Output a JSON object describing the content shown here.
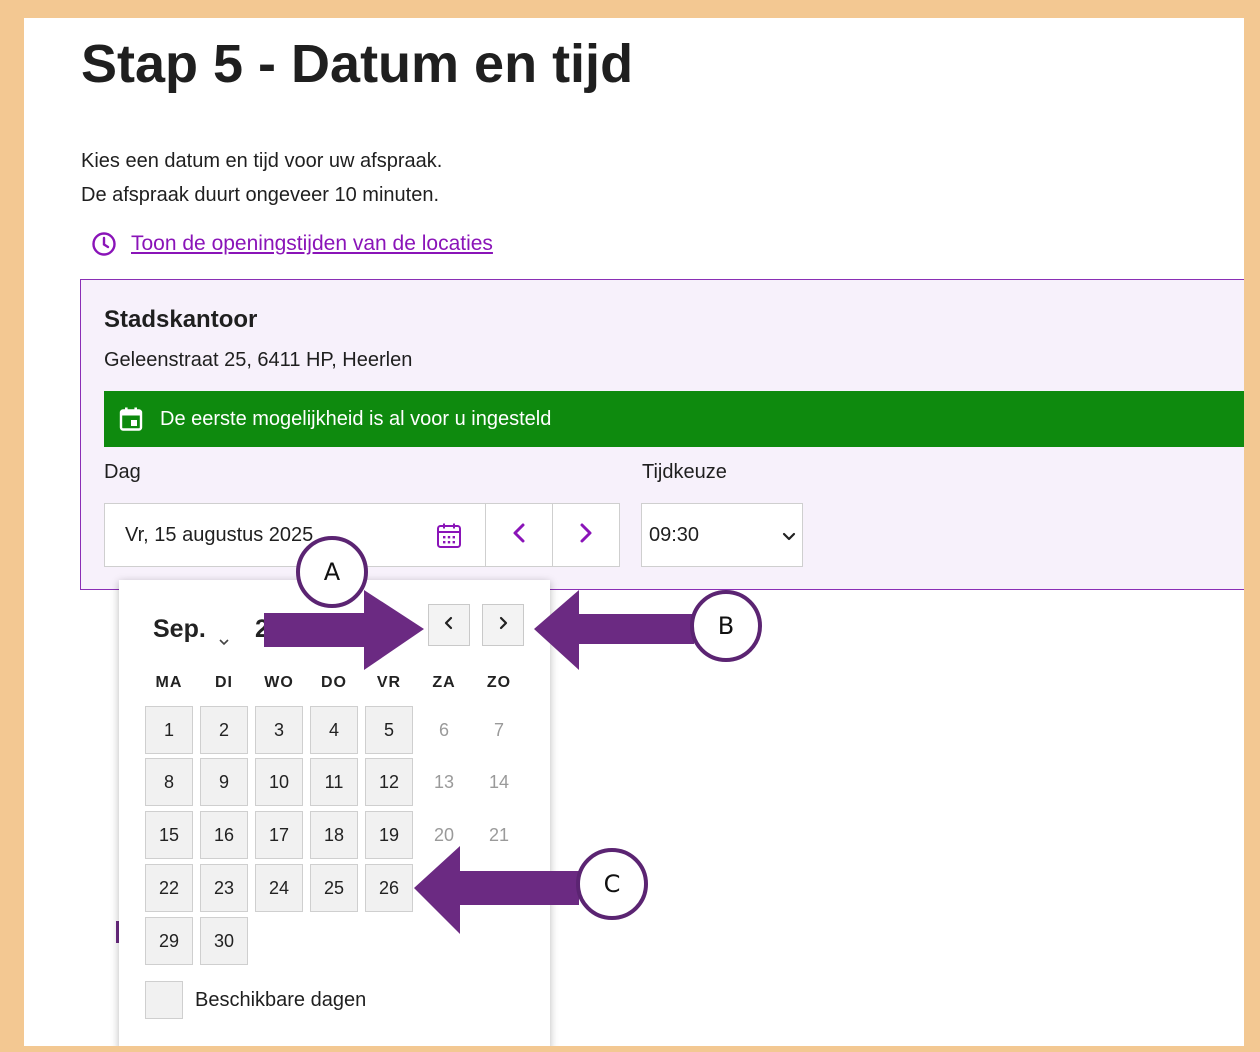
{
  "page": {
    "title": "Stap 5 - Datum en tijd",
    "intro_line1": "Kies een datum en tijd voor uw afspraak.",
    "intro_line2": "De afspraak duurt ongeveer 10 minuten.",
    "hours_link": "Toon de openingstijden van de locaties"
  },
  "location": {
    "name": "Stadskantoor",
    "address": "Geleenstraat 25, 6411 HP, Heerlen",
    "banner": "De eerste mogelijkheid is al voor u ingesteld"
  },
  "form": {
    "day_label": "Dag",
    "day_value": "Vr, 15 augustus 2025",
    "time_label": "Tijdkeuze",
    "time_value": "09:30",
    "prev_day_glyph": "<",
    "next_day_glyph": ">"
  },
  "datepicker": {
    "month_label": "Sep.",
    "year_visible": "2",
    "weekdays": [
      "MA",
      "DI",
      "WO",
      "DO",
      "VR",
      "ZA",
      "ZO"
    ],
    "weeks": [
      [
        {
          "d": "1",
          "available": true
        },
        {
          "d": "2",
          "available": true
        },
        {
          "d": "3",
          "available": true
        },
        {
          "d": "4",
          "available": true
        },
        {
          "d": "5",
          "available": true
        },
        {
          "d": "6",
          "available": false
        },
        {
          "d": "7",
          "available": false
        }
      ],
      [
        {
          "d": "8",
          "available": true
        },
        {
          "d": "9",
          "available": true
        },
        {
          "d": "10",
          "available": true
        },
        {
          "d": "11",
          "available": true
        },
        {
          "d": "12",
          "available": true
        },
        {
          "d": "13",
          "available": false
        },
        {
          "d": "14",
          "available": false
        }
      ],
      [
        {
          "d": "15",
          "available": true
        },
        {
          "d": "16",
          "available": true
        },
        {
          "d": "17",
          "available": true
        },
        {
          "d": "18",
          "available": true
        },
        {
          "d": "19",
          "available": true
        },
        {
          "d": "20",
          "available": false
        },
        {
          "d": "21",
          "available": false
        }
      ],
      [
        {
          "d": "22",
          "available": true
        },
        {
          "d": "23",
          "available": true
        },
        {
          "d": "24",
          "available": true
        },
        {
          "d": "25",
          "available": true
        },
        {
          "d": "26",
          "available": true
        }
      ],
      [
        {
          "d": "29",
          "available": true
        },
        {
          "d": "30",
          "available": true
        }
      ]
    ],
    "legend": "Beschikbare dagen"
  },
  "annotations": {
    "callout_a": "A",
    "callout_b": "B",
    "callout_c": "C"
  },
  "colors": {
    "frame": "#f3c892",
    "accent_purple": "#8a14b8",
    "banner_green": "#0e8a0e",
    "arrow_purple": "#6b2a82"
  }
}
